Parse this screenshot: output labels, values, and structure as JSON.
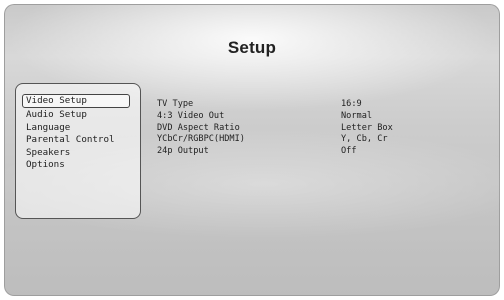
{
  "screen": {
    "title": "Setup"
  },
  "menu": {
    "items": [
      {
        "label": "Video Setup",
        "selected": true
      },
      {
        "label": "Audio Setup",
        "selected": false
      },
      {
        "label": "Language",
        "selected": false
      },
      {
        "label": "Parental Control",
        "selected": false
      },
      {
        "label": "Speakers",
        "selected": false
      },
      {
        "label": "Options",
        "selected": false
      }
    ]
  },
  "settings": {
    "rows": [
      {
        "label": "TV Type",
        "value": "16:9"
      },
      {
        "label": "4:3 Video Out",
        "value": "Normal"
      },
      {
        "label": "DVD Aspect Ratio",
        "value": "Letter Box"
      },
      {
        "label": "YCbCr/RGBPC(HDMI)",
        "value": "Y, Cb, Cr"
      },
      {
        "label": "24p Output",
        "value": "Off"
      }
    ]
  }
}
